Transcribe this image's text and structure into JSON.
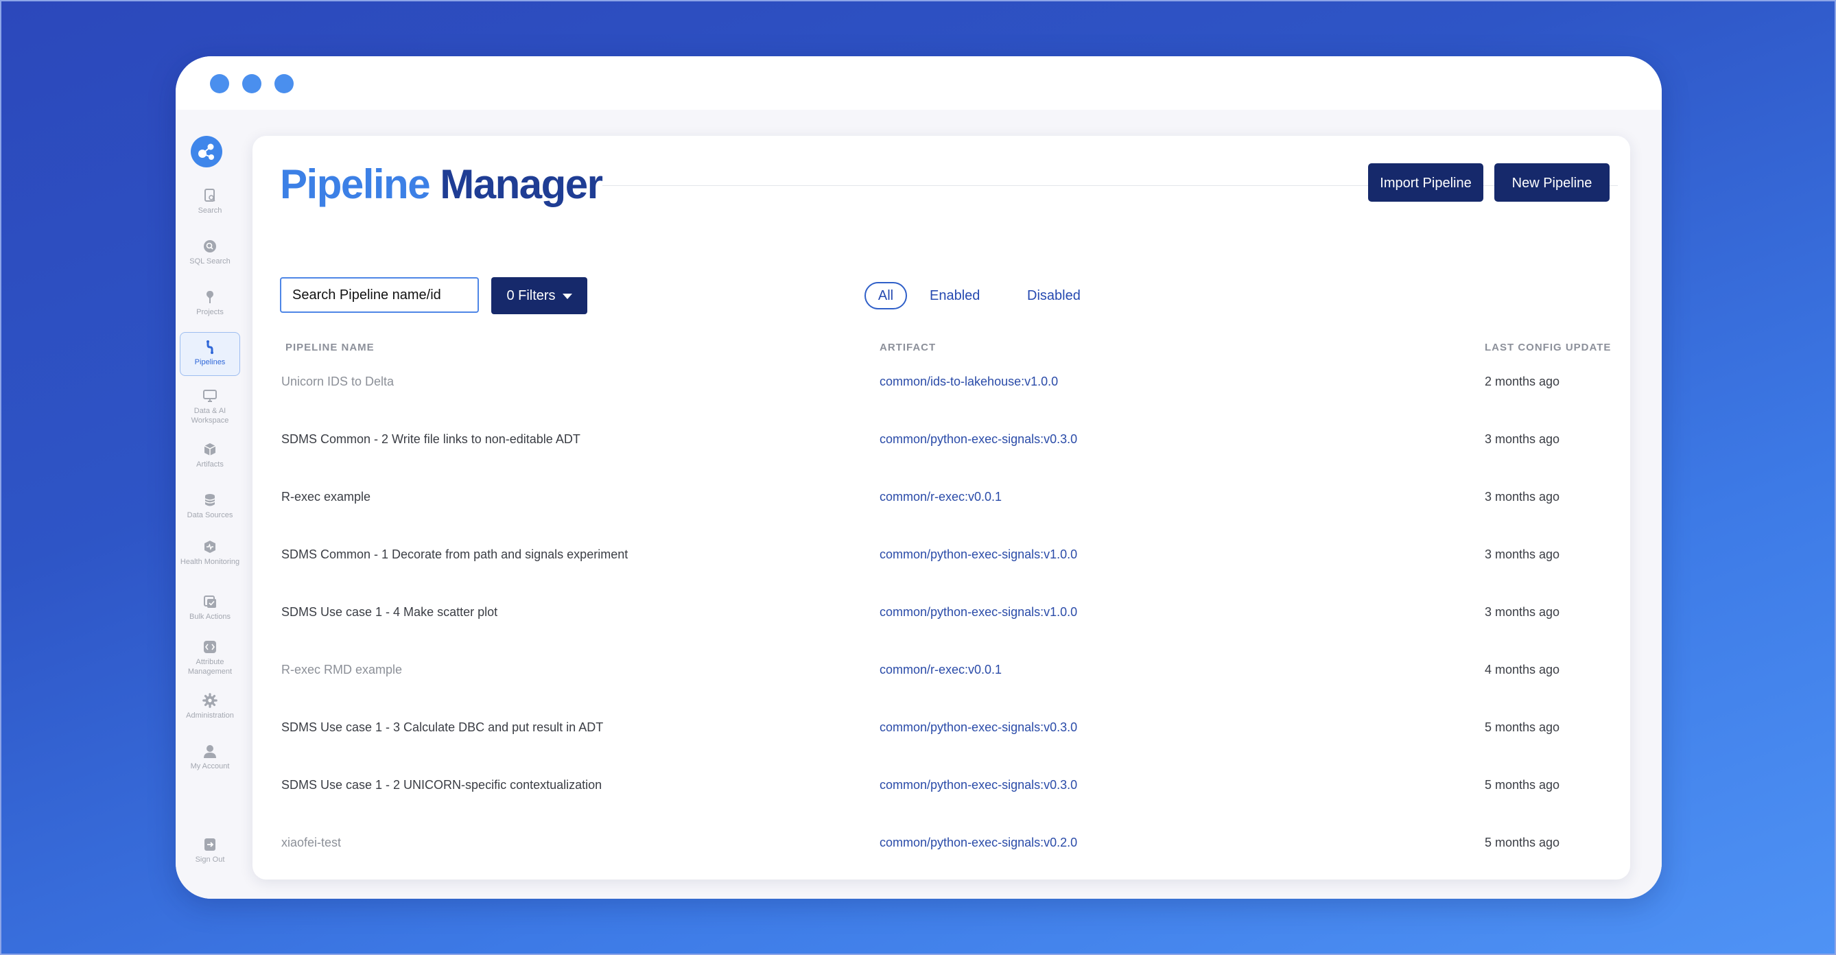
{
  "app": {
    "title_part1": "Pipeline",
    "title_part2": "Manager"
  },
  "sidebar": {
    "items": [
      {
        "label": "Search",
        "icon": "document-search-icon"
      },
      {
        "label": "SQL Search",
        "icon": "magnifier-icon"
      },
      {
        "label": "Projects",
        "icon": "pin-icon"
      },
      {
        "label": "Pipelines",
        "icon": "pipeline-icon",
        "active": true
      },
      {
        "label": "Data & AI Workspace",
        "icon": "monitor-icon"
      },
      {
        "label": "Artifacts",
        "icon": "cube-icon"
      },
      {
        "label": "Data Sources",
        "icon": "database-icon"
      },
      {
        "label": "Health Monitoring",
        "icon": "health-icon"
      },
      {
        "label": "Bulk Actions",
        "icon": "checklist-icon"
      },
      {
        "label": "Attribute Management",
        "icon": "attribute-icon"
      },
      {
        "label": "Administration",
        "icon": "gear-icon"
      },
      {
        "label": "My Account",
        "icon": "user-icon"
      }
    ],
    "sign_out": {
      "label": "Sign Out",
      "icon": "sign-out-icon"
    }
  },
  "toolbar": {
    "import_label": "Import Pipeline",
    "new_label": "New Pipeline"
  },
  "search": {
    "placeholder": "Search Pipeline name/id"
  },
  "filters": {
    "label": "0 Filters"
  },
  "tabs": [
    {
      "label": "All",
      "active": true
    },
    {
      "label": "Enabled"
    },
    {
      "label": "Disabled"
    }
  ],
  "table": {
    "columns": [
      "PIPELINE NAME",
      "ARTIFACT",
      "LAST CONFIG UPDATE"
    ],
    "rows": [
      {
        "name": "Unicorn IDS to Delta",
        "artifact": "common/ids-to-lakehouse:v1.0.0",
        "updated": "2 months ago",
        "disabled": true
      },
      {
        "name": "SDMS Common - 2 Write file links to non-editable ADT",
        "artifact": "common/python-exec-signals:v0.3.0",
        "updated": "3 months ago"
      },
      {
        "name": "R-exec example",
        "artifact": "common/r-exec:v0.0.1",
        "updated": "3 months ago"
      },
      {
        "name": "SDMS Common - 1 Decorate from path and signals experiment",
        "artifact": "common/python-exec-signals:v1.0.0",
        "updated": "3 months ago"
      },
      {
        "name": "SDMS Use case 1 - 4 Make scatter plot",
        "artifact": "common/python-exec-signals:v1.0.0",
        "updated": "3 months ago"
      },
      {
        "name": "R-exec RMD example",
        "artifact": "common/r-exec:v0.0.1",
        "updated": "4 months ago",
        "disabled": true
      },
      {
        "name": "SDMS Use case 1 - 3 Calculate DBC and put result in ADT",
        "artifact": "common/python-exec-signals:v0.3.0",
        "updated": "5 months ago"
      },
      {
        "name": "SDMS Use case 1 - 2 UNICORN-specific contextualization",
        "artifact": "common/python-exec-signals:v0.3.0",
        "updated": "5 months ago"
      },
      {
        "name": "xiaofei-test",
        "artifact": "common/python-exec-signals:v0.2.0",
        "updated": "5 months ago",
        "disabled": true
      }
    ]
  },
  "colors": {
    "background": "#2e55c6",
    "primary_button": "#16296b",
    "title_light": "#3c80e6",
    "title_dark": "#1f3d94",
    "link": "#2a4ba8"
  }
}
